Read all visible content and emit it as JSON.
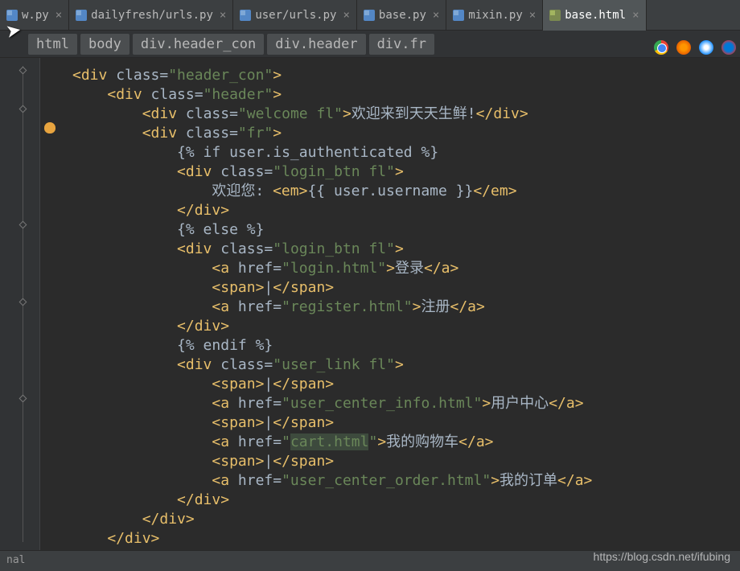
{
  "tabs": [
    {
      "label": "w.py",
      "icon": "py"
    },
    {
      "label": "dailyfresh/urls.py",
      "icon": "py"
    },
    {
      "label": "user/urls.py",
      "icon": "py"
    },
    {
      "label": "base.py",
      "icon": "py"
    },
    {
      "label": "mixin.py",
      "icon": "py"
    },
    {
      "label": "base.html",
      "icon": "html",
      "active": true
    }
  ],
  "breadcrumb": [
    "html",
    "body",
    "div.header_con",
    "div.header",
    "div.fr"
  ],
  "code_lines": {
    "l1_open": "<div ",
    "l1_attr": "class=",
    "l1_val": "\"header_con\"",
    "l1_close": ">",
    "l2_open": "<div ",
    "l2_attr": "class=",
    "l2_val": "\"header\"",
    "l2_close": ">",
    "l3_open": "<div ",
    "l3_attr": "class=",
    "l3_val": "\"welcome fl\"",
    "l3_close": ">",
    "l3_text": "欢迎来到天天生鲜!",
    "l3_end": "</div>",
    "l4_open": "<div ",
    "l4_attr": "class=",
    "l4_val": "\"fr\"",
    "l4_close": ">",
    "l5_t": "{% if user.is_authenticated %}",
    "l6_open": "<div ",
    "l6_attr": "class=",
    "l6_val": "\"login_btn fl\"",
    "l6_close": ">",
    "l7_text": "欢迎您: ",
    "l7_em_o": "<em>",
    "l7_var": "{{ user.username }}",
    "l7_em_c": "</em>",
    "l8": "</div>",
    "l9_t": "{% else %}",
    "l10_open": "<div ",
    "l10_attr": "class=",
    "l10_val": "\"login_btn fl\"",
    "l10_close": ">",
    "l11_ao": "<a ",
    "l11_href": "href=",
    "l11_hv": "\"login.html\"",
    "l11_ac": ">",
    "l11_txt": "登录",
    "l11_ae": "</a>",
    "l12_so": "<span>",
    "l12_pipe": "|",
    "l12_sc": "</span>",
    "l13_ao": "<a ",
    "l13_href": "href=",
    "l13_hv": "\"register.html\"",
    "l13_ac": ">",
    "l13_txt": "注册",
    "l13_ae": "</a>",
    "l14": "</div>",
    "l15_t": "{% endif %}",
    "l16_open": "<div ",
    "l16_attr": "class=",
    "l16_val": "\"user_link fl\"",
    "l16_close": ">",
    "l17_so": "<span>",
    "l17_pipe": "|",
    "l17_sc": "</span>",
    "l18_ao": "<a ",
    "l18_href": "href=",
    "l18_hv": "\"user_center_info.html\"",
    "l18_ac": ">",
    "l18_txt": "用户中心",
    "l18_ae": "</a>",
    "l19_so": "<span>",
    "l19_pipe": "|",
    "l19_sc": "</span>",
    "l20_ao": "<a ",
    "l20_href": "href=",
    "l20_hv": "\"",
    "l20_hv2": "cart.html",
    "l20_hv3": "\"",
    "l20_ac": ">",
    "l20_txt": "我的购物车",
    "l20_ae": "</a>",
    "l21_so": "<span>",
    "l21_pipe": "|",
    "l21_sc": "</span>",
    "l22_ao": "<a ",
    "l22_href": "href=",
    "l22_hv": "\"user_center_order.html\"",
    "l22_ac": ">",
    "l22_txt": "我的订单",
    "l22_ae": "</a>",
    "l23": "</div>",
    "l24": "</div>",
    "l25": "</div>"
  },
  "bottom_label": "nal",
  "watermark": "https://blog.csdn.net/ifubing"
}
